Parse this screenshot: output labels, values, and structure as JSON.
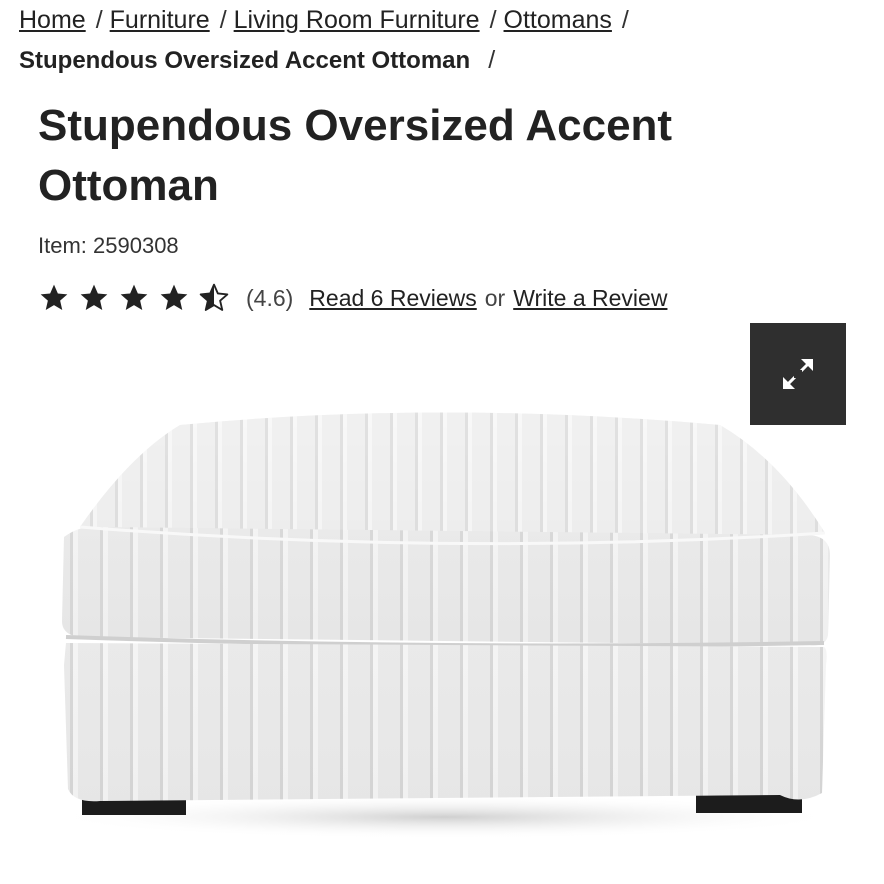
{
  "breadcrumb": {
    "items": [
      "Home",
      "Furniture",
      "Living Room Furniture",
      "Ottomans"
    ],
    "current": "Stupendous Oversized Accent Ottoman",
    "separator": "/"
  },
  "product": {
    "title_line1": "Stupendous Oversized Accent",
    "title_line2": "Ottoman",
    "item_label": "Item: 2590308"
  },
  "rating": {
    "value": 4.6,
    "value_text": "(4.6)",
    "read_reviews": "Read 6 Reviews",
    "or_text": "or",
    "write_review": "Write a Review",
    "star_color": "#222222"
  },
  "expand_button": {
    "icon": "expand-arrows-icon",
    "color": "#2f2f2f"
  },
  "image": {
    "subject": "white ribbed corduroy ottoman"
  }
}
